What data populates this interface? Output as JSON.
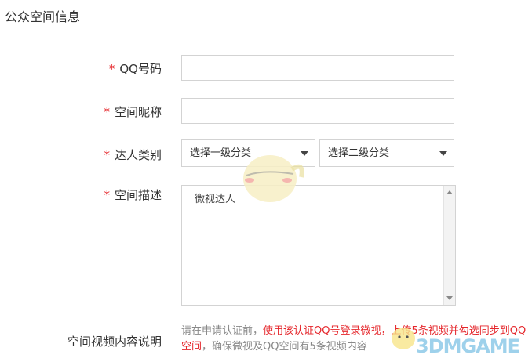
{
  "section": {
    "title": "公众空间信息"
  },
  "form": {
    "qq_label": "QQ号码",
    "name_label": "空间昵称",
    "category_label": "达人类别",
    "desc_label": "空间描述",
    "required_mark": "*",
    "select1": "选择一级分类",
    "select2": "选择二级分类",
    "desc_value": "微视达人",
    "video_label": "空间视频内容说明",
    "note_part1": "请在申请认证前，",
    "note_part2": "使用该认证QQ号登录微视，上传5条视频并勾选同步到QQ空间",
    "note_part3": "，确保微视及QQ空间有5条视频内容"
  },
  "watermark": {
    "text": "3DMGAME"
  }
}
